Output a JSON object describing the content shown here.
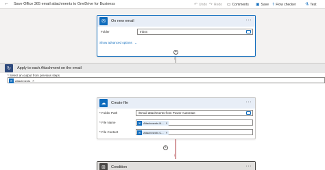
{
  "header": {
    "title": "Save Office 365 email attachments to OneDrive for Business",
    "undo_label": "Undo",
    "redo_label": "Redo",
    "comments_label": "Comments",
    "save_label": "Save",
    "flow_checker_label": "Flow checker",
    "test_label": "Test"
  },
  "trigger": {
    "title": "On new email",
    "folder_label": "Folder",
    "folder_value": "Inbox",
    "show_advanced": "Show advanced options"
  },
  "apply_each": {
    "title": "Apply to each Attachment on the email",
    "select_label": "* Select an output from previous steps",
    "token": "Attachments"
  },
  "create_file": {
    "title": "Create file",
    "folder_path_label": "* Folder Path",
    "folder_path_value": "/Email attachments from Power Automate",
    "file_name_label": "* File Name",
    "file_name_token": "Attachments N...",
    "file_content_label": "* File Content",
    "file_content_token": "Attachments C..."
  },
  "condition": {
    "title": "Condition"
  },
  "colors": {
    "accent": "#0f6cbd",
    "trigger_icon": "#0f6cbd",
    "onedrive_icon": "#0f6cbd",
    "loop_icon": "#2e4a7d",
    "condition_icon": "#484644"
  }
}
